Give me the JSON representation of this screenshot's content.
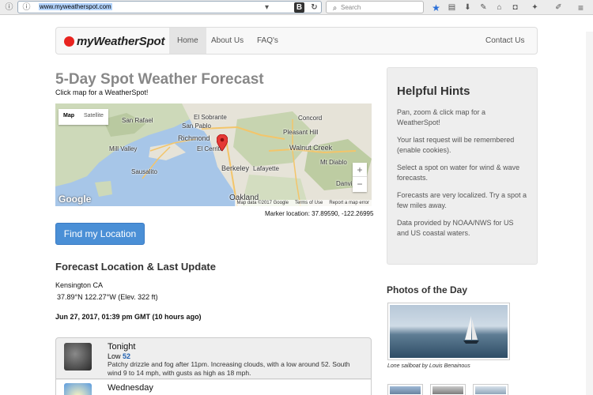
{
  "browser": {
    "url": "www.myweatherspot.com",
    "search_placeholder": "Search",
    "bookmark_badge": "B"
  },
  "site": {
    "logo_text": "myWeatherSpot",
    "nav": {
      "home": "Home",
      "about": "About Us",
      "faq": "FAQ's",
      "contact": "Contact Us"
    }
  },
  "page": {
    "title": "5-Day Spot Weather Forecast",
    "subtitle": "Click map for a WeatherSpot!"
  },
  "map": {
    "type_map": "Map",
    "type_satellite": "Satellite",
    "labels": [
      "San Rafael",
      "El Sobrante",
      "San Pablo",
      "Concord",
      "Pleasant Hill",
      "Richmond",
      "El Cerrito",
      "Mill Valley",
      "Walnut Creek",
      "Sausalito",
      "Mt Diablo",
      "Berkeley",
      "Lafayette",
      "Oakland",
      "Danville"
    ],
    "attribution": [
      "Map data ©2017 Google",
      "Terms of Use",
      "Report a map error"
    ],
    "google": "Google",
    "zoom_in": "+",
    "zoom_out": "−",
    "marker_location": "Marker location: 37.89590, -122.26995"
  },
  "find_button": "Find my Location",
  "forecast": {
    "heading": "Forecast Location & Last Update",
    "location": "Kensington CA",
    "coords": "37.89°N 122.27°W (Elev. 322 ft)",
    "updated": "Jun 27, 2017, 01:39 pm GMT (10 hours ago)",
    "periods": [
      {
        "name": "Tonight",
        "temp_label": "Low",
        "temp": "52",
        "desc": "Patchy drizzle and fog after 11pm. Increasing clouds, with a low around 52. South wind 9 to 14 mph, with gusts as high as 18 mph."
      },
      {
        "name": "Wednesday"
      }
    ]
  },
  "hints": {
    "title": "Helpful Hints",
    "items": [
      "Pan, zoom & click map for a WeatherSpot!",
      "Your last request will be remembered (enable cookies).",
      "Select a spot on water for wind & wave forecasts.",
      "Forecasts are very localized. Try a spot a few miles away.",
      "Data provided by NOAA/NWS for US and US coastal waters."
    ]
  },
  "photos": {
    "title": "Photos of the Day",
    "caption": "Lone sailboat by Louis Benainous"
  },
  "colors": {
    "accent": "#4a8fd6",
    "logo_dot": "#e8231f",
    "temp": "#2060b0"
  }
}
